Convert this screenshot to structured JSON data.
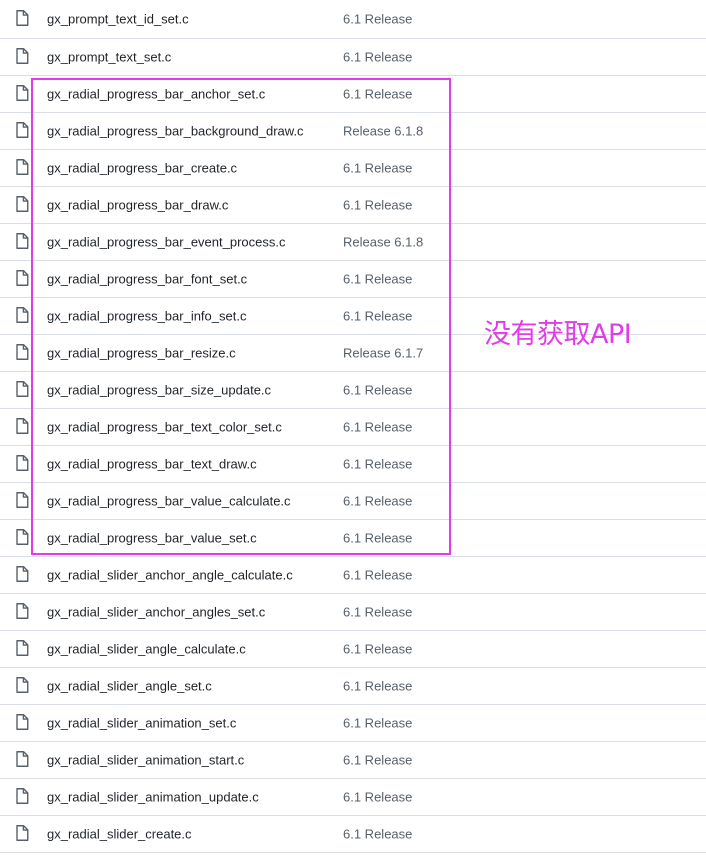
{
  "files": [
    {
      "name": "gx_prompt_text_id_set.c",
      "commit": "6.1 Release",
      "icon": "file-icon"
    },
    {
      "name": "gx_prompt_text_set.c",
      "commit": "6.1 Release",
      "icon": "file-icon"
    },
    {
      "name": "gx_radial_progress_bar_anchor_set.c",
      "commit": "6.1 Release",
      "icon": "file-icon"
    },
    {
      "name": "gx_radial_progress_bar_background_draw.c",
      "commit": "Release 6.1.8",
      "icon": "file-icon"
    },
    {
      "name": "gx_radial_progress_bar_create.c",
      "commit": "6.1 Release",
      "icon": "file-icon"
    },
    {
      "name": "gx_radial_progress_bar_draw.c",
      "commit": "6.1 Release",
      "icon": "file-icon"
    },
    {
      "name": "gx_radial_progress_bar_event_process.c",
      "commit": "Release 6.1.8",
      "icon": "file-icon"
    },
    {
      "name": "gx_radial_progress_bar_font_set.c",
      "commit": "6.1 Release",
      "icon": "file-icon"
    },
    {
      "name": "gx_radial_progress_bar_info_set.c",
      "commit": "6.1 Release",
      "icon": "file-icon"
    },
    {
      "name": "gx_radial_progress_bar_resize.c",
      "commit": "Release 6.1.7",
      "icon": "file-icon"
    },
    {
      "name": "gx_radial_progress_bar_size_update.c",
      "commit": "6.1 Release",
      "icon": "file-icon"
    },
    {
      "name": "gx_radial_progress_bar_text_color_set.c",
      "commit": "6.1 Release",
      "icon": "file-icon"
    },
    {
      "name": "gx_radial_progress_bar_text_draw.c",
      "commit": "6.1 Release",
      "icon": "file-icon"
    },
    {
      "name": "gx_radial_progress_bar_value_calculate.c",
      "commit": "6.1 Release",
      "icon": "file-icon"
    },
    {
      "name": "gx_radial_progress_bar_value_set.c",
      "commit": "6.1 Release",
      "icon": "file-icon"
    },
    {
      "name": "gx_radial_slider_anchor_angle_calculate.c",
      "commit": "6.1 Release",
      "icon": "file-icon"
    },
    {
      "name": "gx_radial_slider_anchor_angles_set.c",
      "commit": "6.1 Release",
      "icon": "file-icon"
    },
    {
      "name": "gx_radial_slider_angle_calculate.c",
      "commit": "6.1 Release",
      "icon": "file-icon"
    },
    {
      "name": "gx_radial_slider_angle_set.c",
      "commit": "6.1 Release",
      "icon": "file-icon"
    },
    {
      "name": "gx_radial_slider_animation_set.c",
      "commit": "6.1 Release",
      "icon": "file-icon"
    },
    {
      "name": "gx_radial_slider_animation_start.c",
      "commit": "6.1 Release",
      "icon": "file-icon"
    },
    {
      "name": "gx_radial_slider_animation_update.c",
      "commit": "6.1 Release",
      "icon": "file-icon"
    },
    {
      "name": "gx_radial_slider_create.c",
      "commit": "6.1 Release",
      "icon": "file-icon"
    }
  ],
  "annotation": {
    "text": "没有获取API",
    "color": "#e23be8"
  }
}
